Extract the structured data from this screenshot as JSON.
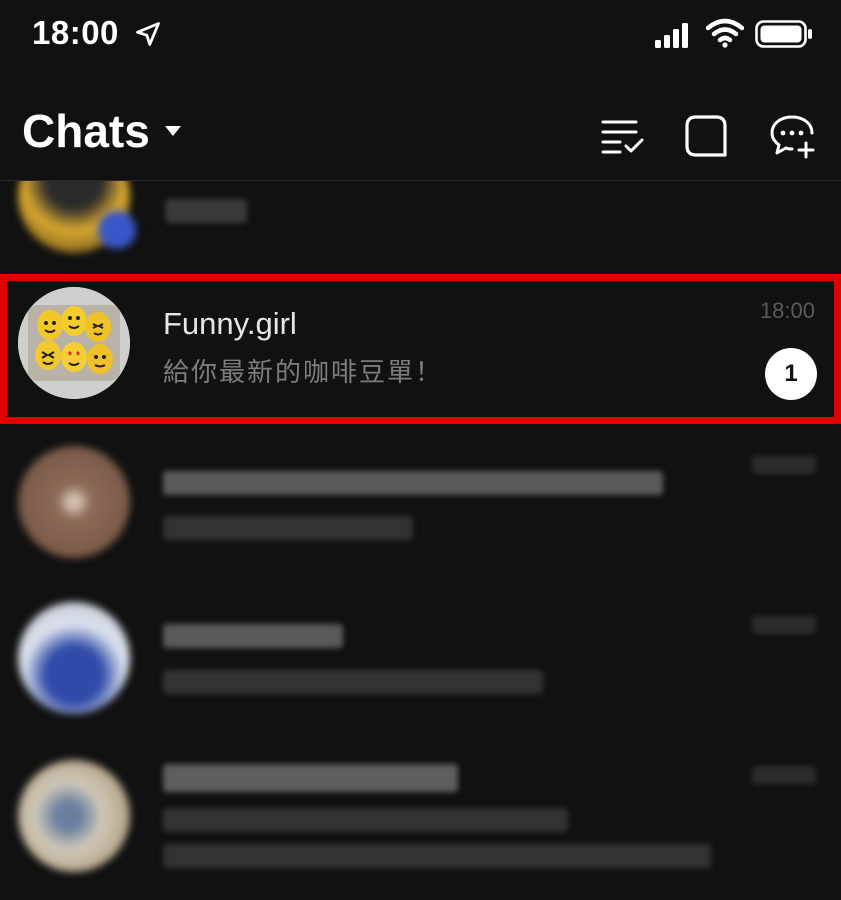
{
  "status_bar": {
    "time": "18:00",
    "icons": [
      "location-arrow-icon",
      "cellular-signal-icon",
      "wifi-icon",
      "battery-icon"
    ]
  },
  "header": {
    "title": "Chats",
    "title_dropdown_icon": "caret-down-icon",
    "actions": [
      "edit-list-icon",
      "compose-square-icon",
      "new-chat-bubble-icon"
    ]
  },
  "chats": {
    "highlighted": {
      "name": "Funny.girl",
      "preview": "給你最新的咖啡豆單！",
      "time": "18:00",
      "unread_count": "1"
    }
  },
  "colors": {
    "background": "#111111",
    "highlight_border": "#e10000",
    "badge_background": "#ffffff",
    "preview_text": "#7d7d7d",
    "time_text": "#5a5a5a"
  }
}
